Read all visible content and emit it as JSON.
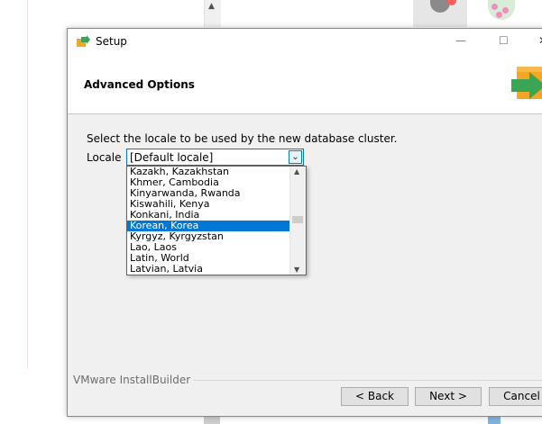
{
  "window": {
    "title": "Setup",
    "page_title": "Advanced Options",
    "minimize_glyph": "—",
    "maximize_glyph": "☐",
    "close_glyph": "✕"
  },
  "form": {
    "instruction": "Select the locale to be used by the new database cluster.",
    "locale_label": "Locale",
    "locale_value": "[Default locale]",
    "dropdown_glyph": "⌄",
    "options": [
      "Kazakh, Kazakhstan",
      "Khmer, Cambodia",
      "Kinyarwanda, Rwanda",
      "Kiswahili, Kenya",
      "Konkani, India",
      "Korean, Korea",
      "Kyrgyz, Kyrgyzstan",
      "Lao, Laos",
      "Latin, World",
      "Latvian, Latvia"
    ],
    "selected_option": "Korean, Korea",
    "scroll_up_glyph": "▲",
    "scroll_down_glyph": "▼"
  },
  "footer": {
    "brand": "VMware InstallBuilder",
    "back_label": "< Back",
    "next_label": "Next >",
    "cancel_label": "Cancel"
  },
  "background": {
    "scroll_up_glyph": "▲"
  },
  "colors": {
    "selection": "#0078d7",
    "logo_green": "#3aa655",
    "logo_orange": "#f5a623"
  },
  "icons": {
    "app": "setup-box-arrow-icon",
    "header_logo": "installer-arrow-logo-icon"
  }
}
